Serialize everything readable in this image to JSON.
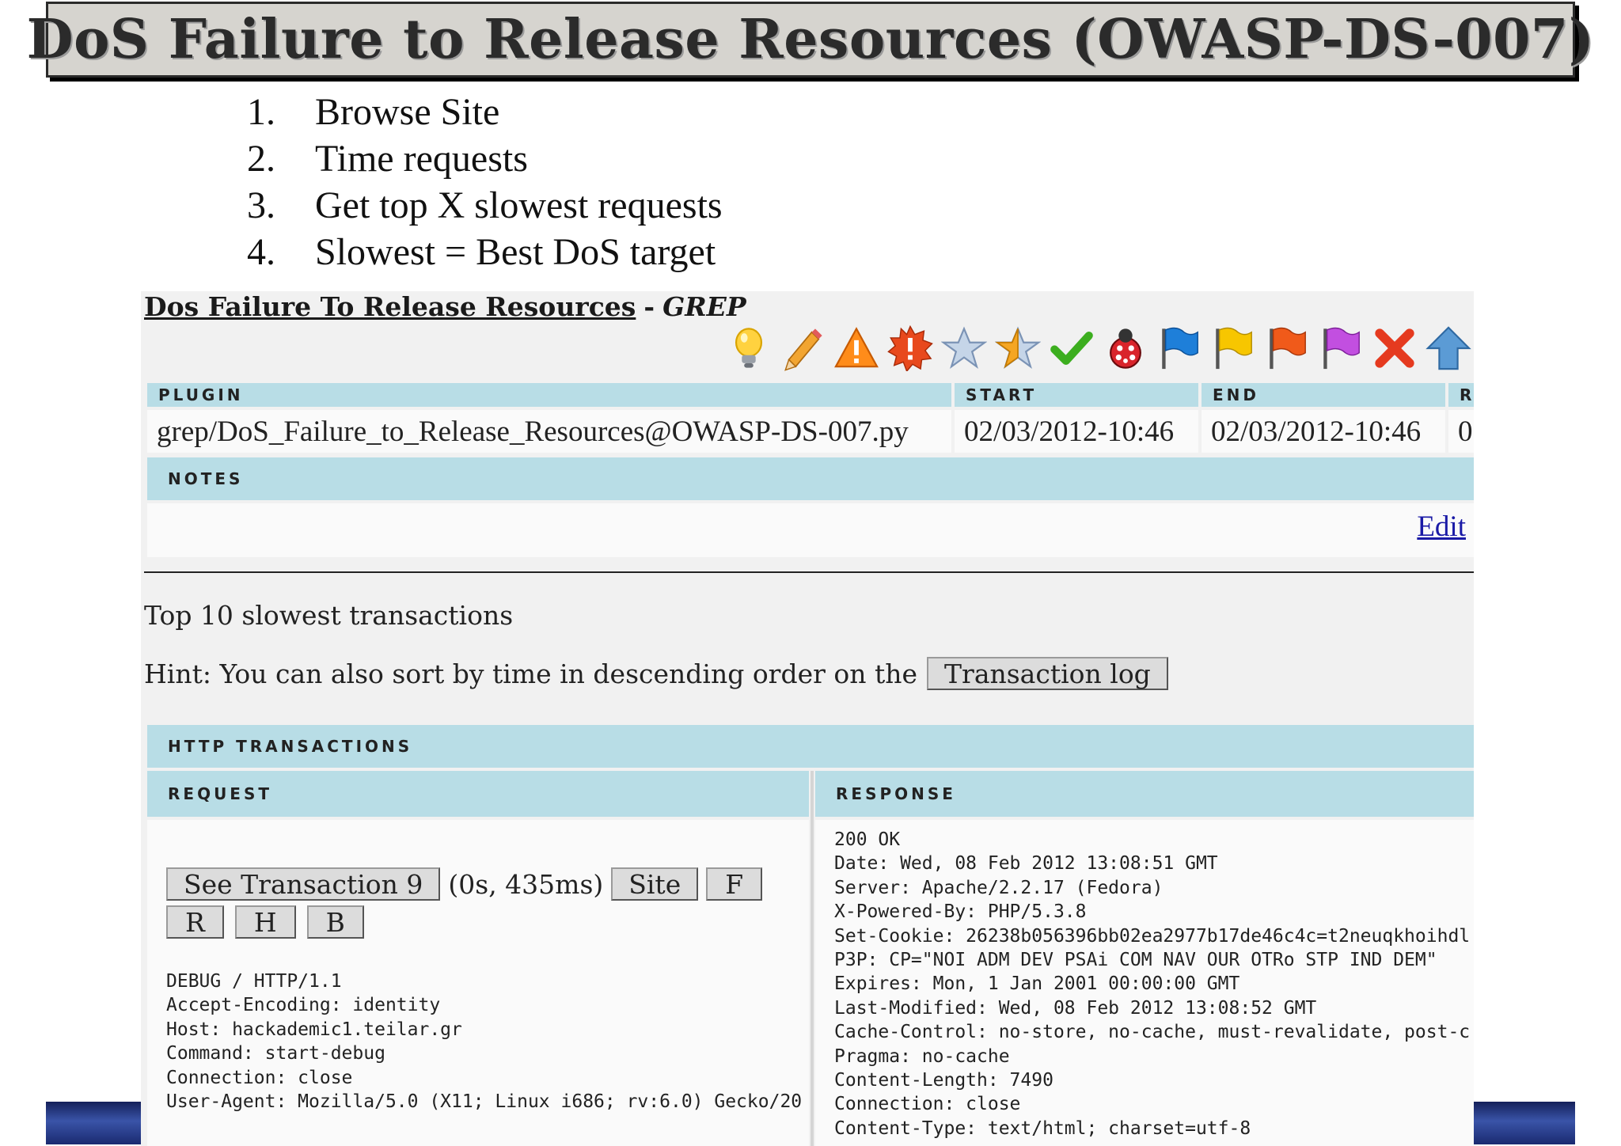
{
  "slide": {
    "title": "DoS Failure to Release Resources (OWASP-DS-007)",
    "bullets": [
      {
        "num": "1.",
        "text": "Browse Site"
      },
      {
        "num": "2.",
        "text": "Time requests"
      },
      {
        "num": "3.",
        "text": "Get top X slowest requests"
      },
      {
        "num": "4.",
        "text": "Slowest = Best DoS target"
      }
    ]
  },
  "screenshot": {
    "title_link": "Dos Failure To Release Resources",
    "title_sep": "-",
    "title_tag": "GREP",
    "toolbar_icons": [
      "lightbulb-icon",
      "pencil-icon",
      "warning-icon",
      "alert-burst-icon",
      "star-empty-icon",
      "star-half-icon",
      "checkmark-icon",
      "bug-icon",
      "flag-blue-icon",
      "flag-yellow-icon",
      "flag-orange-icon",
      "flag-purple-icon",
      "delete-x-icon",
      "arrow-up-icon"
    ],
    "table": {
      "headers": [
        "PLUGIN",
        "START",
        "END",
        "R"
      ],
      "row": [
        "grep/DoS_Failure_to_Release_Resources@OWASP-DS-007.py",
        "02/03/2012-10:46",
        "02/03/2012-10:46",
        "0"
      ]
    },
    "notes_header": "NOTES",
    "edit_label": "Edit",
    "top_text": "Top 10 slowest transactions",
    "hint_text": "Hint: You can also sort by time in descending order on the",
    "transaction_log_button": "Transaction log",
    "http_header": "HTTP TRANSACTIONS",
    "request_header": "REQUEST",
    "response_header": "RESPONSE",
    "see_transaction_button": "See Transaction 9",
    "timing": "(0s, 435ms)",
    "site_button": "Site",
    "f_button": "F",
    "r_button": "R",
    "h_button": "H",
    "b_button": "B",
    "request_lines": "DEBUG / HTTP/1.1\nAccept-Encoding: identity\nHost: hackademic1.teilar.gr\nCommand: start-debug\nConnection: close\nUser-Agent: Mozilla/5.0 (X11; Linux i686; rv:6.0) Gecko/20",
    "response_lines": "200 OK\nDate: Wed, 08 Feb 2012 13:08:51 GMT\nServer: Apache/2.2.17 (Fedora)\nX-Powered-By: PHP/5.3.8\nSet-Cookie: 26238b056396bb02ea2977b17de46c4c=t2neuqkhoihdl\nP3P: CP=\"NOI ADM DEV PSAi COM NAV OUR OTRo STP IND DEM\"\nExpires: Mon, 1 Jan 2001 00:00:00 GMT\nLast-Modified: Wed, 08 Feb 2012 13:08:52 GMT\nCache-Control: no-store, no-cache, must-revalidate, post-c\nPragma: no-cache\nContent-Length: 7490\nConnection: close\nContent-Type: text/html; charset=utf-8"
  }
}
